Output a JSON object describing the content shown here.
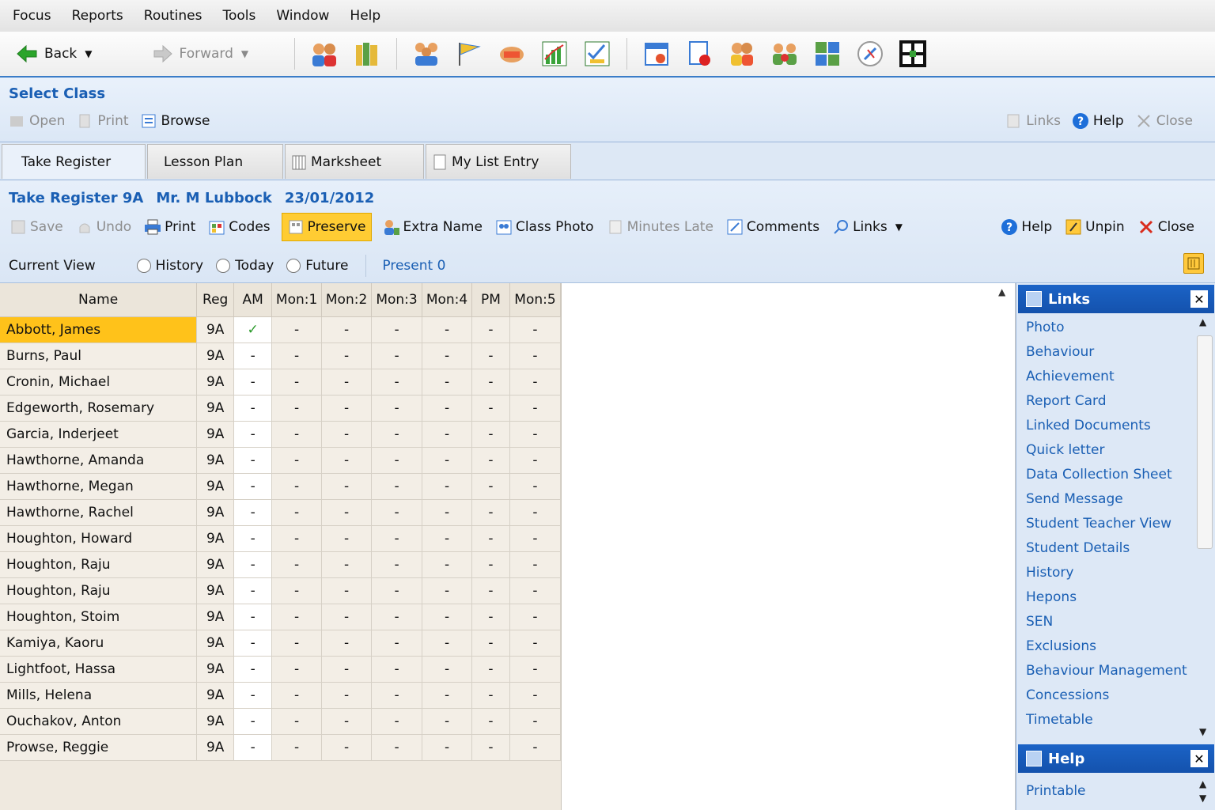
{
  "menu": [
    "Focus",
    "Reports",
    "Routines",
    "Tools",
    "Window",
    "Help"
  ],
  "toolbar": {
    "back_label": "Back",
    "forward_label": "Forward",
    "icons": [
      "people-pair-icon",
      "books-icon",
      "group-icon",
      "flag-icon",
      "hands-icon",
      "chart-icon",
      "checklist-chart-icon",
      "calendar-icon",
      "report-card-icon",
      "staff-pair-icon",
      "meeting-icon",
      "grid-people-icon",
      "compass-icon",
      "layout-icon"
    ]
  },
  "select_class": {
    "title": "Select Class",
    "open": "Open",
    "print": "Print",
    "browse": "Browse",
    "links": "Links",
    "help": "Help",
    "close": "Close"
  },
  "tabs": [
    "Take Register",
    "Lesson Plan",
    "Marksheet",
    "My List Entry"
  ],
  "register": {
    "title": "Take Register 9A",
    "teacher": "Mr. M Lubbock",
    "date": "23/01/2012",
    "actions": {
      "save": "Save",
      "undo": "Undo",
      "print": "Print",
      "codes": "Codes",
      "preserve": "Preserve",
      "extra_name": "Extra Name",
      "class_photo": "Class Photo",
      "minutes_late": "Minutes Late",
      "comments": "Comments",
      "links": "Links",
      "help": "Help",
      "unpin": "Unpin",
      "close": "Close"
    },
    "current_view_label": "Current View",
    "view_options": [
      "History",
      "Today",
      "Future"
    ],
    "present_label": "Present 0"
  },
  "grid": {
    "columns": [
      "Name",
      "Reg",
      "AM",
      "Mon:1",
      "Mon:2",
      "Mon:3",
      "Mon:4",
      "PM",
      "Mon:5"
    ],
    "rows": [
      {
        "name": "Abbott, James",
        "reg": "9A",
        "am": "✓",
        "selected": true
      },
      {
        "name": "Burns, Paul",
        "reg": "9A",
        "am": "-"
      },
      {
        "name": "Cronin, Michael",
        "reg": "9A",
        "am": "-"
      },
      {
        "name": "Edgeworth, Rosemary",
        "reg": "9A",
        "am": "-"
      },
      {
        "name": "Garcia, Inderjeet",
        "reg": "9A",
        "am": "-"
      },
      {
        "name": "Hawthorne, Amanda",
        "reg": "9A",
        "am": "-"
      },
      {
        "name": "Hawthorne, Megan",
        "reg": "9A",
        "am": "-"
      },
      {
        "name": "Hawthorne, Rachel",
        "reg": "9A",
        "am": "-"
      },
      {
        "name": "Houghton, Howard",
        "reg": "9A",
        "am": "-"
      },
      {
        "name": "Houghton, Raju",
        "reg": "9A",
        "am": "-"
      },
      {
        "name": "Houghton, Raju",
        "reg": "9A",
        "am": "-"
      },
      {
        "name": "Houghton, Stoim",
        "reg": "9A",
        "am": "-"
      },
      {
        "name": "Kamiya, Kaoru",
        "reg": "9A",
        "am": "-"
      },
      {
        "name": "Lightfoot, Hassa",
        "reg": "9A",
        "am": "-"
      },
      {
        "name": "Mills, Helena",
        "reg": "9A",
        "am": "-"
      },
      {
        "name": "Ouchakov, Anton",
        "reg": "9A",
        "am": "-"
      },
      {
        "name": "Prowse, Reggie",
        "reg": "9A",
        "am": "-"
      }
    ],
    "empty_mark": "-"
  },
  "links_panel": {
    "title": "Links",
    "items": [
      "Photo",
      "Behaviour",
      "Achievement",
      "Report Card",
      "Linked Documents",
      "Quick letter",
      "Data Collection Sheet",
      "Send Message",
      "Student Teacher View",
      "Student Details",
      "History",
      "Hepons",
      "SEN",
      "Exclusions",
      "Behaviour Management",
      "Concessions",
      "Timetable"
    ]
  },
  "help_panel": {
    "title": "Help",
    "items": [
      "Printable"
    ]
  },
  "colors": {
    "accent": "#1a5fb4",
    "selected_row": "#ffc21a",
    "preserve": "#ffcc33",
    "close_x": "#d92b1c",
    "check": "#2a9a2a"
  }
}
